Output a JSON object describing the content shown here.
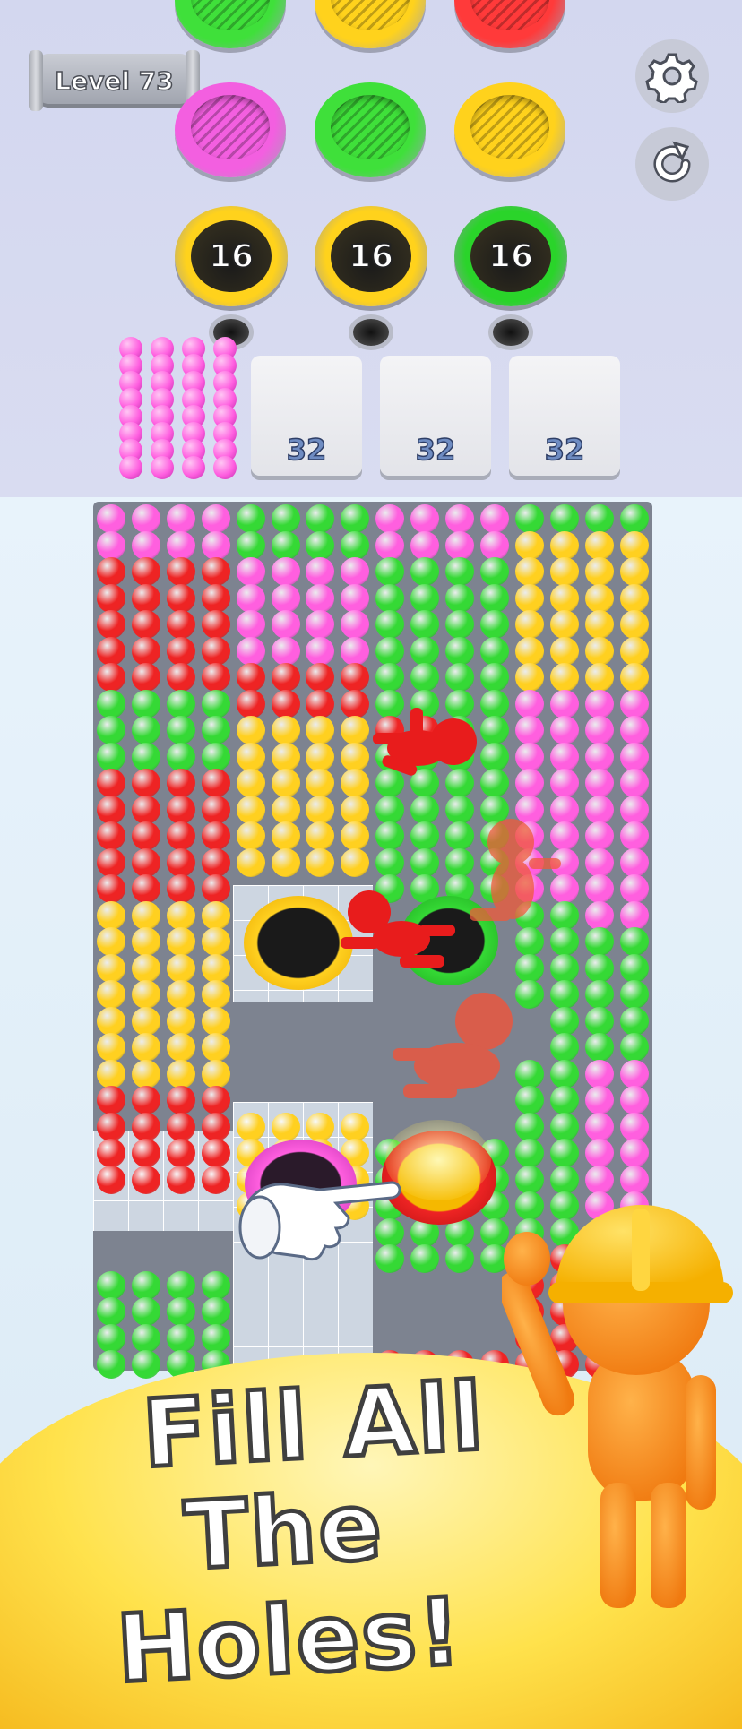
{
  "level": {
    "label": "Level 73"
  },
  "controls": {
    "settings_icon": "gear-icon",
    "restart_icon": "restart-icon"
  },
  "lids": [
    {
      "color": "#3fe03a"
    },
    {
      "color": "#ffd21c"
    },
    {
      "color": "#ff3a3a"
    },
    {
      "color": "#f35fe0"
    },
    {
      "color": "#3fe03a"
    },
    {
      "color": "#ffd21c"
    }
  ],
  "holes": [
    {
      "count": "16",
      "color": "#ffd21c"
    },
    {
      "count": "16",
      "color": "#ffd21c"
    },
    {
      "count": "16",
      "color": "#2ad42a"
    }
  ],
  "slots": [
    {
      "count": "32"
    },
    {
      "count": "32"
    },
    {
      "count": "32"
    }
  ],
  "queue": {
    "color": "#ff5fe0"
  },
  "board": {
    "colors": {
      "g": "#35d935",
      "p": "#ff5fdf",
      "r": "#ee2424",
      "y": "#ffd020"
    }
  },
  "caption": {
    "line1": "Fill All",
    "line2": "The Holes!"
  }
}
